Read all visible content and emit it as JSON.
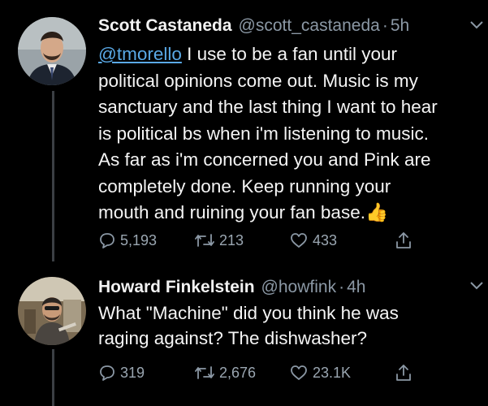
{
  "tweets": [
    {
      "name": "Scott Castaneda",
      "handle": "@scott_castaneda",
      "dot": "·",
      "time": "5h",
      "mention": "@tmorello",
      "lines": [
        " I use to be a fan until your",
        "political opinions come out. Music is my",
        "sanctuary and the last thing I want to hear",
        "is political bs when i'm listening to music.",
        "As far as i'm concerned you and Pink are",
        "completely done. Keep running your",
        "mouth and ruining your fan base."
      ],
      "emoji": "👍",
      "replies": "5,193",
      "retweets": "213",
      "likes": "433"
    },
    {
      "name": "Howard Finkelstein",
      "handle": "@howfink",
      "dot": "·",
      "time": "4h",
      "lines": [
        "What \"Machine\" did you think he was",
        "raging against? The dishwasher?"
      ],
      "replies": "319",
      "retweets": "2,676",
      "likes": "23.1K"
    }
  ],
  "icons": {
    "reply": "reply-icon",
    "retweet": "retweet-icon",
    "like": "heart-icon",
    "share": "share-icon",
    "more": "chevron-down-icon"
  }
}
